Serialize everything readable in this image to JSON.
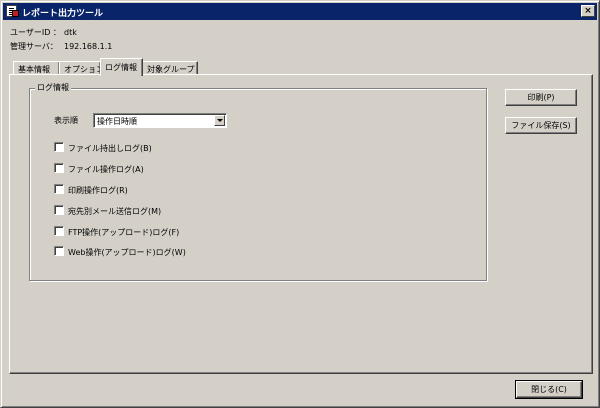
{
  "window": {
    "title": "レポート出力ツール",
    "close_glyph": "×"
  },
  "info": {
    "user_id_label": "ユーザーID ：",
    "user_id_value": "dtk",
    "server_label": "管理サーバ：",
    "server_value": "192.168.1.1"
  },
  "tabs": [
    {
      "label": "基本情報"
    },
    {
      "label": "オプション"
    },
    {
      "label": "ログ情報"
    },
    {
      "label": "対象グループ"
    }
  ],
  "log_group": {
    "title": "ログ情報",
    "order_label": "表示順",
    "order_value": "操作日時順",
    "checkboxes": [
      {
        "label": "ファイル持出しログ(B)",
        "checked": false
      },
      {
        "label": "ファイル操作ログ(A)",
        "checked": false
      },
      {
        "label": "印刷操作ログ(R)",
        "checked": false
      },
      {
        "label": "宛先別メール送信ログ(M)",
        "checked": false
      },
      {
        "label": "FTP操作(アップロード)ログ(F)",
        "checked": false
      },
      {
        "label": "Web操作(アップロード)ログ(W)",
        "checked": false
      }
    ]
  },
  "buttons": {
    "print": "印刷(P)",
    "save_file": "ファイル保存(S)",
    "close": "閉じる(C)"
  }
}
